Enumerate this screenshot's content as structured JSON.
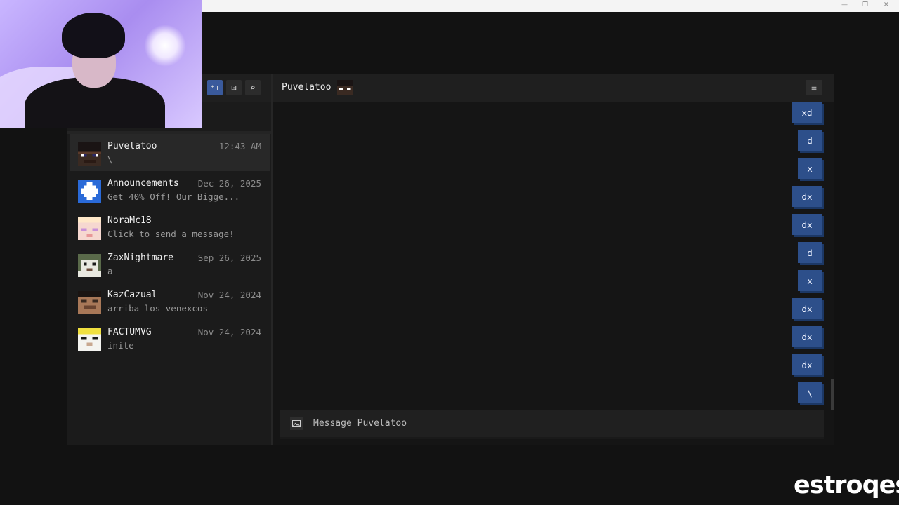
{
  "window": {
    "controls": [
      "—",
      "❐",
      "✕"
    ]
  },
  "sidebar": {
    "buttons": [
      {
        "icon": "add-friend-icon",
        "glyph": "⁺+"
      },
      {
        "icon": "new-group-icon",
        "glyph": "⊡"
      },
      {
        "icon": "search-icon",
        "glyph": "⌕"
      }
    ],
    "conversations": [
      {
        "name": "Puvelatoo",
        "preview": "\\",
        "date": "12:43 AM"
      },
      {
        "name": "Announcements",
        "preview": "Get 40% Off! Our Bigge...",
        "date": "Dec 26, 2025"
      },
      {
        "name": "NoraMc18",
        "preview": "Click to send a message!",
        "date": ""
      },
      {
        "name": "ZaxNightmare",
        "preview": "a",
        "date": "Sep 26, 2025"
      },
      {
        "name": "KazCazual",
        "preview": "arriba los venexcos",
        "date": "Nov 24, 2024"
      },
      {
        "name": "FACTUMVG",
        "preview": "inite",
        "date": "Nov 24, 2024"
      }
    ]
  },
  "chat": {
    "title": "Puvelatoo",
    "menu_icon": "≡",
    "messages": [
      "xd",
      "d",
      "x",
      "dx",
      "dx",
      "d",
      "x",
      "dx",
      "dx",
      "dx",
      "\\"
    ],
    "composer_placeholder": "Message Puvelatoo"
  },
  "watermark": "estroqes"
}
